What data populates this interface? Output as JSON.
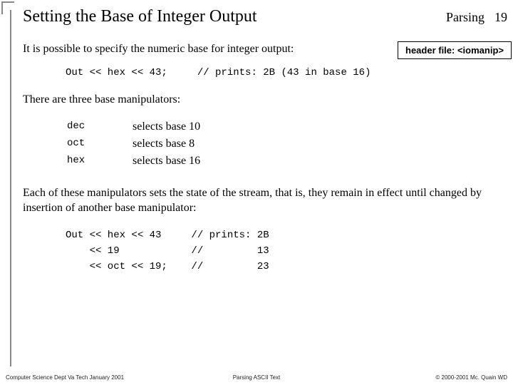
{
  "title": "Setting the Base of Integer Output",
  "topic": "Parsing",
  "page_number": "19",
  "intro": "It is possible to specify the numeric base for integer output:",
  "header_file": "header file: <iomanip>",
  "code1": "Out << hex << 43;     // prints: 2B (43 in base 16)",
  "three_intro": "There are three base manipulators:",
  "manipulators": [
    {
      "name": "dec",
      "desc": "selects base 10"
    },
    {
      "name": "oct",
      "desc": "selects base 8"
    },
    {
      "name": "hex",
      "desc": "selects base 16"
    }
  ],
  "persist": "Each of these manipulators sets the state of the stream, that is, they remain in effect until changed by insertion of another base manipulator:",
  "code2": "Out << hex << 43     // prints: 2B\n    << 19            //         13\n    << oct << 19;    //         23",
  "footer": {
    "left": "Computer Science Dept Va Tech January 2001",
    "center": "Parsing ASCII Text",
    "right": "© 2000-2001 Mc. Quain WD"
  }
}
